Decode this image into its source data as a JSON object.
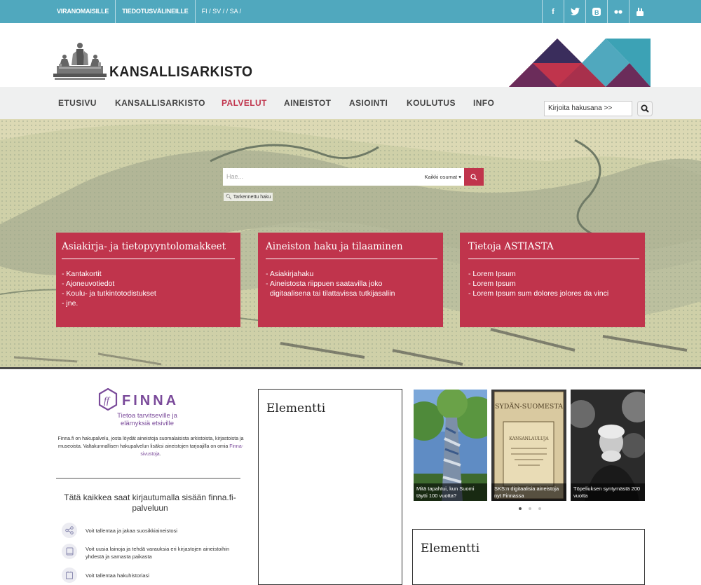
{
  "topbar": {
    "links": [
      "VIRANOMAISILLE",
      "TIEDOTUSVÄLINEILLE"
    ],
    "languages": "FI / SV / / SA /",
    "social": [
      "facebook-icon",
      "twitter-icon",
      "blogger-icon",
      "flickr-icon",
      "youtube-icon"
    ]
  },
  "header": {
    "logo_text": "KANSALLISARKISTO"
  },
  "nav": {
    "items": [
      "ETUSIVU",
      "KANSALLISARKISTO",
      "PALVELUT",
      "AINEISTOT",
      "ASIOINTI",
      "KOULUTUS",
      "INFO"
    ],
    "active": "PALVELUT",
    "search_value": "Kirjoita hakusana >>"
  },
  "hero": {
    "search_placeholder": "Hae...",
    "search_scope": "Kaikki osumat",
    "advanced_link": "Tarkennettu haku"
  },
  "cards": [
    {
      "title": "Asiakirja- ja tietopyyntolomakkeet",
      "items": [
        "- Kantakortit",
        "- Ajoneuvotiedot",
        "- Koulu- ja tutkintotodistukset",
        "- jne."
      ]
    },
    {
      "title": "Aineiston haku ja tilaaminen",
      "items": [
        "- Asiakirjahaku",
        "- Aineistosta riippuen saatavilla joko",
        "  digitaalisena tai tilattavissa tutkijasaliin"
      ]
    },
    {
      "title": "Tietoja ASTIASTA",
      "items": [
        "- Lorem Ipsum",
        "- Lorem Ipsum",
        "- Lorem Ipsum sum dolores jolores da vinci"
      ]
    }
  ],
  "finna": {
    "name": "FINNA",
    "tagline": "Tietoa tarvitseville ja elämyksiä etsiville",
    "description": "Finna.fi on hakupalvelu, josta löydät aineistoja suomalaisista arkistoista, kirjastoista ja museoista. Valtakunnallisen hakupalvelun lisäksi aineistojen tarjoajilla on omia",
    "description_link": "Finna-sivustoja",
    "description_end": ".",
    "login_heading": "Tätä kaikkea saat kirjautumalla sisään finna.fi-palveluun",
    "features": [
      {
        "icon": "share-icon",
        "text": "Voit tallentaa ja jakaa suosikkiaineistosi"
      },
      {
        "icon": "book-icon",
        "text": "Voit uusia lainoja ja tehdä varauksia eri kirjastojen aineistoihin yhdestä ja samasta paikasta"
      },
      {
        "icon": "history-icon",
        "text": "Voit tallentaa hakuhistoriasi"
      }
    ]
  },
  "elements": [
    "Elementti",
    "Elementti"
  ],
  "carousel": {
    "captions": [
      "Mitä tapahtui, kun Suomi täytti 100 vuotta?",
      "SKS:n digitaalisia aineistoja nyt Finnassa",
      "Töpeliuksen syntymästä 200 vuotta"
    ],
    "book_cover_title": "SYDÄN-SUOMESTA",
    "book_cover_label": "KANSANLAULUJA",
    "active_dot": 0
  },
  "colors": {
    "topbar": "#50a8be",
    "accent": "#c0344c",
    "finna": "#7a4a9a"
  }
}
